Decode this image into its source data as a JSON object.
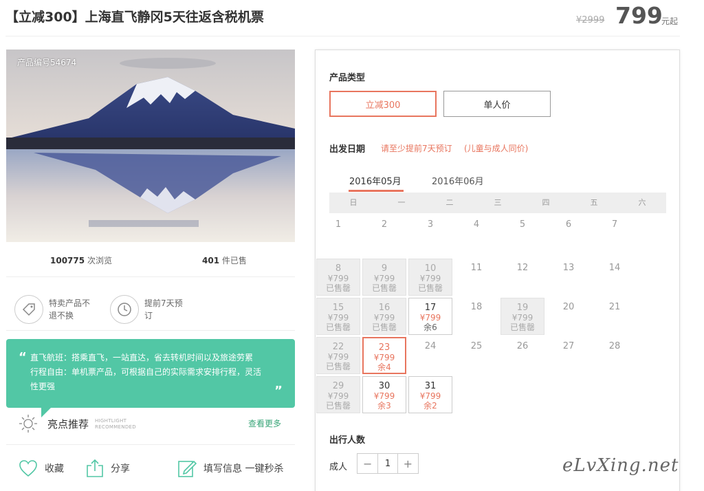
{
  "header": {
    "title": "【立减300】上海直飞静冈5天往返含税机票",
    "price_old": "¥2999",
    "price_now": "799",
    "price_suffix": "元起"
  },
  "hero": {
    "product_no": "产品编号54674"
  },
  "stats": {
    "views": "100775",
    "views_label": "次浏览",
    "sold": "401",
    "sold_label": "件已售"
  },
  "features": [
    {
      "icon": "tag-icon",
      "text": "特卖产品不退不换"
    },
    {
      "icon": "clock-icon",
      "text": "提前7天预订"
    }
  ],
  "highlight_box": {
    "line1": "直飞航班：搭乘直飞，一站直达，省去转机时间以及旅途劳累",
    "line2": "行程自由：单机票产品，可根据自己的实际需求安排行程，灵活性更强"
  },
  "highlights": {
    "label": "亮点推荐",
    "en1": "HIGHTLIGHT",
    "en2": "RECOMMENDED",
    "more": "查看更多"
  },
  "actions": {
    "favorite": "收藏",
    "share": "分享",
    "fill_info": "填写信息 一键秒杀"
  },
  "panel": {
    "type_title": "产品类型",
    "types": [
      "立减300",
      "单人价"
    ],
    "date_title": "出发日期",
    "note1": "请至少提前7天预订",
    "note2": "(儿童与成人同价)",
    "months": [
      "2016年05月",
      "2016年06月"
    ],
    "weekdays": [
      "日",
      "一",
      "二",
      "三",
      "四",
      "五",
      "六"
    ],
    "calendar": [
      {
        "d": "1",
        "s": "plain"
      },
      {
        "d": "2",
        "s": "plain"
      },
      {
        "d": "3",
        "s": "plain"
      },
      {
        "d": "4",
        "s": "plain"
      },
      {
        "d": "5",
        "s": "plain"
      },
      {
        "d": "6",
        "s": "plain"
      },
      {
        "d": "7",
        "s": "plain"
      },
      {
        "d": "8",
        "s": "soldout",
        "p": "¥799",
        "x": "已售罄"
      },
      {
        "d": "9",
        "s": "soldout",
        "p": "¥799",
        "x": "已售罄"
      },
      {
        "d": "10",
        "s": "soldout",
        "p": "¥799",
        "x": "已售罄"
      },
      {
        "d": "11",
        "s": "plain"
      },
      {
        "d": "12",
        "s": "plain"
      },
      {
        "d": "13",
        "s": "plain"
      },
      {
        "d": "14",
        "s": "plain"
      },
      {
        "d": "15",
        "s": "soldout",
        "p": "¥799",
        "x": "已售罄"
      },
      {
        "d": "16",
        "s": "soldout",
        "p": "¥799",
        "x": "已售罄"
      },
      {
        "d": "17",
        "s": "avail",
        "p": "¥799",
        "x": "余6",
        "g": true
      },
      {
        "d": "18",
        "s": "plain"
      },
      {
        "d": "19",
        "s": "soldout",
        "p": "¥799",
        "x": "已售罄"
      },
      {
        "d": "20",
        "s": "plain"
      },
      {
        "d": "21",
        "s": "plain"
      },
      {
        "d": "22",
        "s": "soldout",
        "p": "¥799",
        "x": "已售罄"
      },
      {
        "d": "23",
        "s": "selected",
        "p": "¥799",
        "x": "余4"
      },
      {
        "d": "24",
        "s": "plain"
      },
      {
        "d": "25",
        "s": "plain"
      },
      {
        "d": "26",
        "s": "plain"
      },
      {
        "d": "27",
        "s": "plain"
      },
      {
        "d": "28",
        "s": "plain"
      },
      {
        "d": "29",
        "s": "soldout",
        "p": "¥799",
        "x": "已售罄"
      },
      {
        "d": "30",
        "s": "avail",
        "p": "¥799",
        "x": "余3"
      },
      {
        "d": "31",
        "s": "avail",
        "p": "¥799",
        "x": "余2"
      }
    ],
    "pax_title": "出行人数",
    "pax_label": "成人",
    "pax_value": "1",
    "minus": "−",
    "plus": "+"
  },
  "watermark": "eLvXing.net",
  "colors": {
    "accent": "#e8755e",
    "green": "#52c7a5"
  }
}
